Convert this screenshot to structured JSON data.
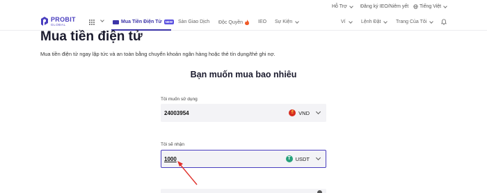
{
  "topbar": {
    "support": "Hỗ Trợ",
    "ieo_register": "Đăng ký IEO/Niêm yết",
    "language": "Tiếng Việt"
  },
  "nav": {
    "logo_main": "PROBIT",
    "logo_sub": "GLOBAL",
    "items": [
      {
        "label": "Mua Tiền Điện Tử",
        "badge": "NEW",
        "active": true
      },
      {
        "label": "Sàn Giao Dịch"
      },
      {
        "label": "Độc Quyền"
      },
      {
        "label": "IEO"
      },
      {
        "label": "Sự Kiện"
      }
    ],
    "right_items": [
      {
        "label": "Ví"
      },
      {
        "label": "Lệnh Đặt"
      },
      {
        "label": "Trang Của Tôi"
      }
    ]
  },
  "page": {
    "title": "Mua tiền điện tử",
    "description": "Mua tiền điện tử ngay lập tức và an toàn bằng chuyển khoản ngân hàng hoặc thẻ tín dụng/thẻ ghi nợ.",
    "section_title": "Bạn muốn mua bao nhiêu"
  },
  "spend": {
    "label": "Tôi muốn sử dụng",
    "value": "24003954",
    "currency": "VND"
  },
  "receive": {
    "label": "Tôi sẽ nhận",
    "value": "1000",
    "currency": "USDT"
  },
  "colors": {
    "brand": "#3c34a8",
    "accent_new": "#5a50e0",
    "field_bg": "#f3f3f6",
    "annotation_arrow": "#e0302a"
  }
}
